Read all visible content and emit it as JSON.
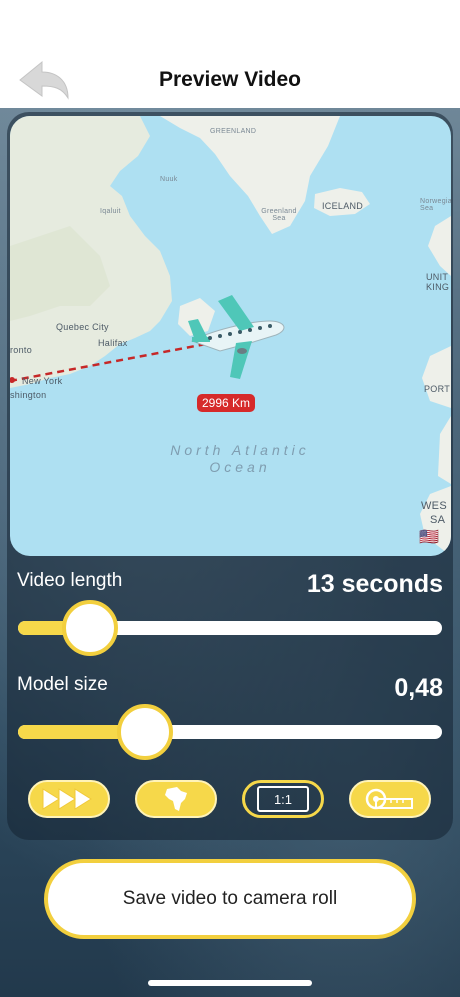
{
  "header": {
    "title": "Preview Video"
  },
  "map": {
    "labels": {
      "greenland": "GREENLAND",
      "iceland": "ICELAND",
      "greenland_sea": "Greenland Sea",
      "norwegian_sea": "Norwegian Sea",
      "quebec_city": "Quebec City",
      "halifax": "Halifax",
      "toronto": "ronto",
      "new_york": "New York",
      "washington": "shington",
      "united_kingdom_1": "UNIT",
      "united_kingdom_2": "KING",
      "portugal": "PORT",
      "western_sahara_1": "WES",
      "western_sahara_2": "SA",
      "ocean_line1": "North Atlantic",
      "ocean_line2": "Ocean",
      "nuuk": "Nuuk",
      "iqaluit": "Iqaluit"
    },
    "distance_badge": "2996 Km",
    "flag": "🇺🇸"
  },
  "video_length": {
    "label": "Video length",
    "value": "13 seconds",
    "fraction": 0.17
  },
  "model_size": {
    "label": "Model size",
    "value": "0,48",
    "fraction": 0.3
  },
  "tools": [
    {
      "name": "speed",
      "icon": "fast-forward-icon"
    },
    {
      "name": "continent",
      "icon": "africa-icon"
    },
    {
      "name": "ratio",
      "icon": "aspect-ratio-icon",
      "label": "1:1"
    },
    {
      "name": "distance",
      "icon": "ruler-tape-icon"
    }
  ],
  "save": {
    "label": "Save video to camera roll"
  },
  "colors": {
    "accent": "#f6d84a",
    "badge": "#d62a2a",
    "ocean": "#aee0f2",
    "land": "#eef0ea"
  }
}
